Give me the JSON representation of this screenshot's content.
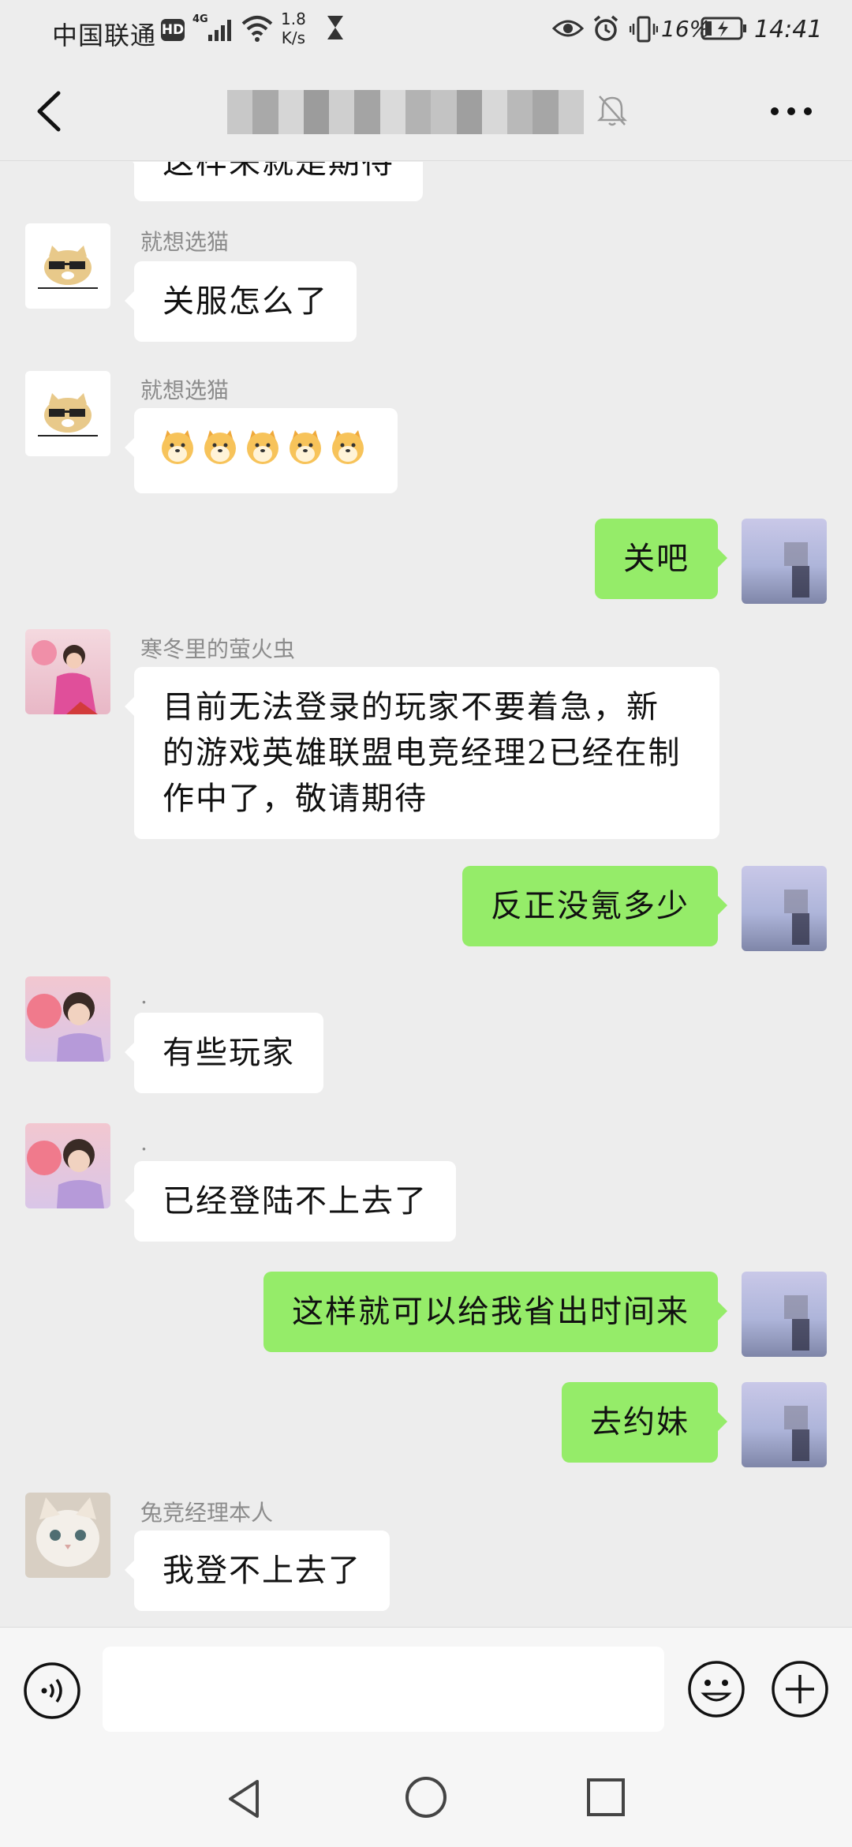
{
  "status_bar": {
    "carrier": "中国联通",
    "hd": "HD",
    "network": "4G",
    "speed_value": "1.8",
    "speed_unit": "K/s",
    "battery": "16%",
    "time": "14:41"
  },
  "header": {
    "title": "",
    "muted": true
  },
  "messages": [
    {
      "side": "in",
      "sender": "",
      "text": "这样来就是期待",
      "partial": true
    },
    {
      "side": "in",
      "sender": "就想选猫",
      "text": "关服怎么了",
      "avatar": "doge-sunglasses"
    },
    {
      "side": "in",
      "sender": "就想选猫",
      "text": "",
      "emoji_count": 5,
      "emoji": "doge-emoji",
      "avatar": "doge-sunglasses"
    },
    {
      "side": "out",
      "text": "关吧"
    },
    {
      "side": "in",
      "sender": "寒冬里的萤火虫",
      "text": "目前无法登录的玩家不要着急，新的游戏英雄联盟电竞经理2已经在制作中了，敬请期待",
      "avatar": "girl-pink"
    },
    {
      "side": "out",
      "text": "反正没氪多少"
    },
    {
      "side": "in",
      "sender": ".",
      "text": "有些玩家",
      "avatar": "boy-purple"
    },
    {
      "side": "in",
      "sender": ".",
      "text": "已经登陆不上去了",
      "avatar": "boy-purple"
    },
    {
      "side": "out",
      "text": "这样就可以给我省出时间来"
    },
    {
      "side": "out",
      "text": "去约妹"
    },
    {
      "side": "in",
      "sender": "兔竞经理本人",
      "text": "我登不上去了",
      "avatar": "white-cat"
    }
  ],
  "input_bar": {
    "placeholder": "",
    "voice_icon": "voice-icon",
    "emoji_icon": "emoji-icon",
    "plus_icon": "plus-icon"
  },
  "colors": {
    "background": "#ededed",
    "outgoing_bubble": "#95ec69",
    "incoming_bubble": "#ffffff"
  }
}
